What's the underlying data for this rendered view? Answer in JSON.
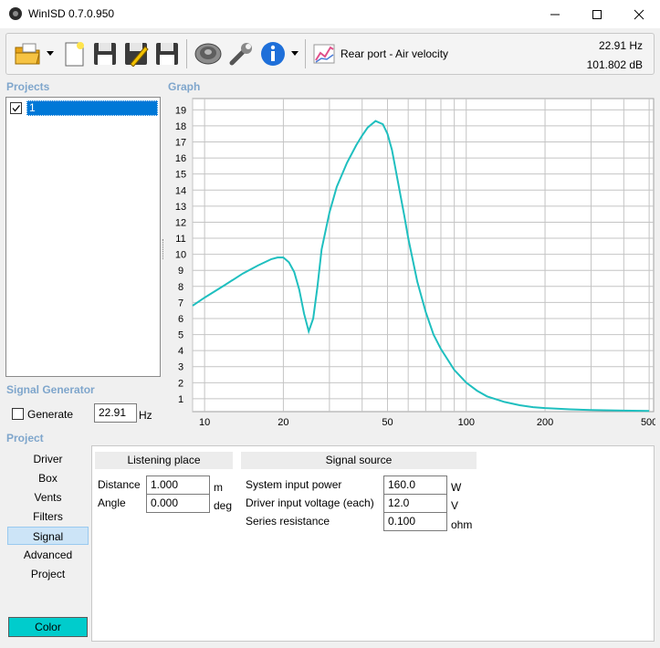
{
  "window": {
    "title": "WinISD 0.7.0.950"
  },
  "toolbar": {
    "view_label": "Rear port - Air velocity",
    "frequency": "22.91 Hz",
    "level": "101.802 dB"
  },
  "projects": {
    "title": "Projects",
    "items": [
      {
        "name": "1",
        "checked": true
      }
    ]
  },
  "graph": {
    "title": "Graph"
  },
  "signal_generator": {
    "title": "Signal Generator",
    "generate_label": "Generate",
    "frequency": "22.91",
    "unit": "Hz"
  },
  "project_panel": {
    "title": "Project",
    "nav": [
      "Driver",
      "Box",
      "Vents",
      "Filters",
      "Signal",
      "Advanced",
      "Project"
    ],
    "active_nav": "Signal",
    "color_button": "Color",
    "listening_place": {
      "title": "Listening place",
      "distance_label": "Distance",
      "distance": "1.000",
      "distance_unit": "m",
      "angle_label": "Angle",
      "angle": "0.000",
      "angle_unit": "deg"
    },
    "signal_source": {
      "title": "Signal source",
      "power_label": "System input power",
      "power": "160.0",
      "power_unit": "W",
      "voltage_label": "Driver input voltage (each)",
      "voltage": "12.0",
      "voltage_unit": "V",
      "resistance_label": "Series resistance",
      "resistance": "0.100",
      "resistance_unit": "ohm"
    }
  },
  "colors": {
    "curve": "#1fbfbf",
    "selection": "#0078d7",
    "section_title": "#7fa6cc",
    "color_swatch": "#00cccc"
  },
  "chart_data": {
    "type": "line",
    "x_scale": "log",
    "xlim": [
      9,
      520
    ],
    "ylim": [
      0.2,
      19.7
    ],
    "x_ticks": [
      10,
      20,
      50,
      100,
      200,
      500
    ],
    "y_ticks": [
      1,
      2,
      3,
      4,
      5,
      6,
      7,
      8,
      9,
      10,
      11,
      12,
      13,
      14,
      15,
      16,
      17,
      18,
      19
    ],
    "grid": true,
    "series": [
      {
        "x": [
          9,
          10,
          12,
          14,
          16,
          18,
          19,
          20,
          21,
          22,
          23,
          24,
          25,
          26,
          27,
          28,
          30,
          32,
          35,
          38,
          40,
          42,
          45,
          48,
          50,
          52,
          55,
          58,
          60,
          65,
          70,
          75,
          80,
          90,
          100,
          110,
          120,
          140,
          160,
          180,
          200,
          250,
          300,
          400,
          500
        ],
        "y": [
          6.8,
          7.3,
          8.1,
          8.8,
          9.3,
          9.7,
          9.8,
          9.8,
          9.5,
          8.9,
          7.8,
          6.3,
          5.2,
          6.0,
          8.0,
          10.3,
          12.6,
          14.2,
          15.7,
          16.8,
          17.4,
          17.9,
          18.3,
          18.1,
          17.5,
          16.5,
          14.4,
          12.4,
          11.0,
          8.3,
          6.4,
          5.0,
          4.1,
          2.8,
          2.0,
          1.5,
          1.15,
          0.8,
          0.6,
          0.48,
          0.42,
          0.34,
          0.3,
          0.26,
          0.24
        ]
      }
    ]
  }
}
